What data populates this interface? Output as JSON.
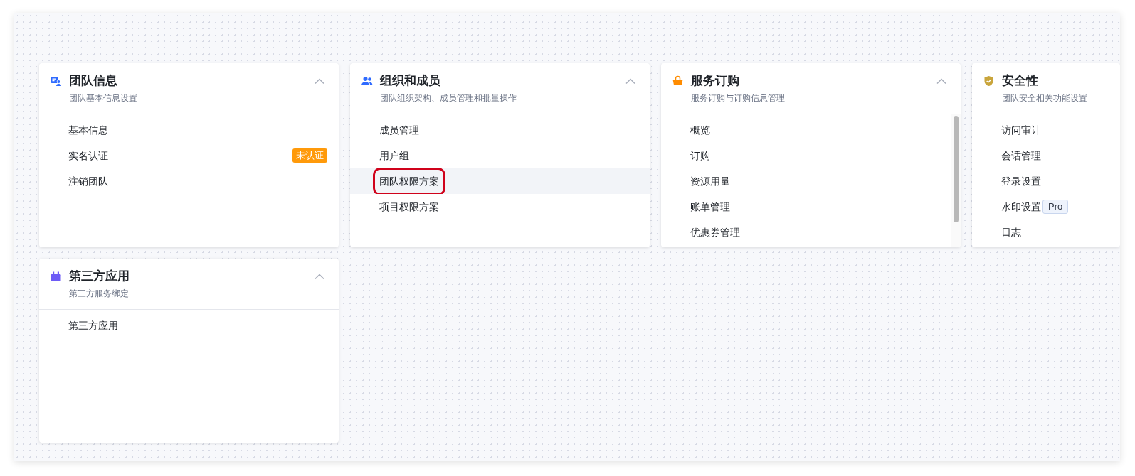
{
  "sections": [
    {
      "kind": "id-card",
      "title": "团队信息",
      "subtitle": "团队基本信息设置",
      "expanded": true,
      "scrollable": false,
      "items": [
        {
          "label": "基本信息",
          "highlighted": false,
          "outlined": false
        },
        {
          "label": "实名认证",
          "highlighted": false,
          "outlined": false,
          "badge": {
            "text": "未认证",
            "kind": "warning"
          }
        },
        {
          "label": "注销团队",
          "highlighted": false,
          "outlined": false
        }
      ]
    },
    {
      "kind": "users",
      "title": "组织和成员",
      "subtitle": "团队组织架构、成员管理和批量操作",
      "expanded": true,
      "scrollable": false,
      "items": [
        {
          "label": "成员管理",
          "highlighted": false,
          "outlined": false
        },
        {
          "label": "用户组",
          "highlighted": false,
          "outlined": false
        },
        {
          "label": "团队权限方案",
          "highlighted": true,
          "outlined": true
        },
        {
          "label": "项目权限方案",
          "highlighted": false,
          "outlined": false
        }
      ]
    },
    {
      "kind": "basket",
      "title": "服务订购",
      "subtitle": "服务订购与订购信息管理",
      "expanded": true,
      "scrollable": true,
      "items": [
        {
          "label": "概览",
          "highlighted": false,
          "outlined": false
        },
        {
          "label": "订购",
          "highlighted": false,
          "outlined": false
        },
        {
          "label": "资源用量",
          "highlighted": false,
          "outlined": false
        },
        {
          "label": "账单管理",
          "highlighted": false,
          "outlined": false
        },
        {
          "label": "优惠券管理",
          "highlighted": false,
          "outlined": false
        }
      ]
    },
    {
      "kind": "shield",
      "title": "安全性",
      "subtitle": "团队安全相关功能设置",
      "scrollable": false,
      "items": [
        {
          "label": "访问审计",
          "highlighted": false,
          "outlined": false
        },
        {
          "label": "会话管理",
          "highlighted": false,
          "outlined": false
        },
        {
          "label": "登录设置",
          "highlighted": false,
          "outlined": false
        },
        {
          "label": "水印设置",
          "highlighted": false,
          "outlined": false,
          "badge": {
            "text": "Pro",
            "kind": "plan"
          }
        },
        {
          "label": "日志",
          "highlighted": false,
          "outlined": false
        }
      ]
    },
    {
      "kind": "plug",
      "title": "第三方应用",
      "subtitle": "第三方服务绑定",
      "expanded": true,
      "scrollable": false,
      "items": [
        {
          "label": "第三方应用",
          "highlighted": false,
          "outlined": false
        }
      ]
    }
  ]
}
